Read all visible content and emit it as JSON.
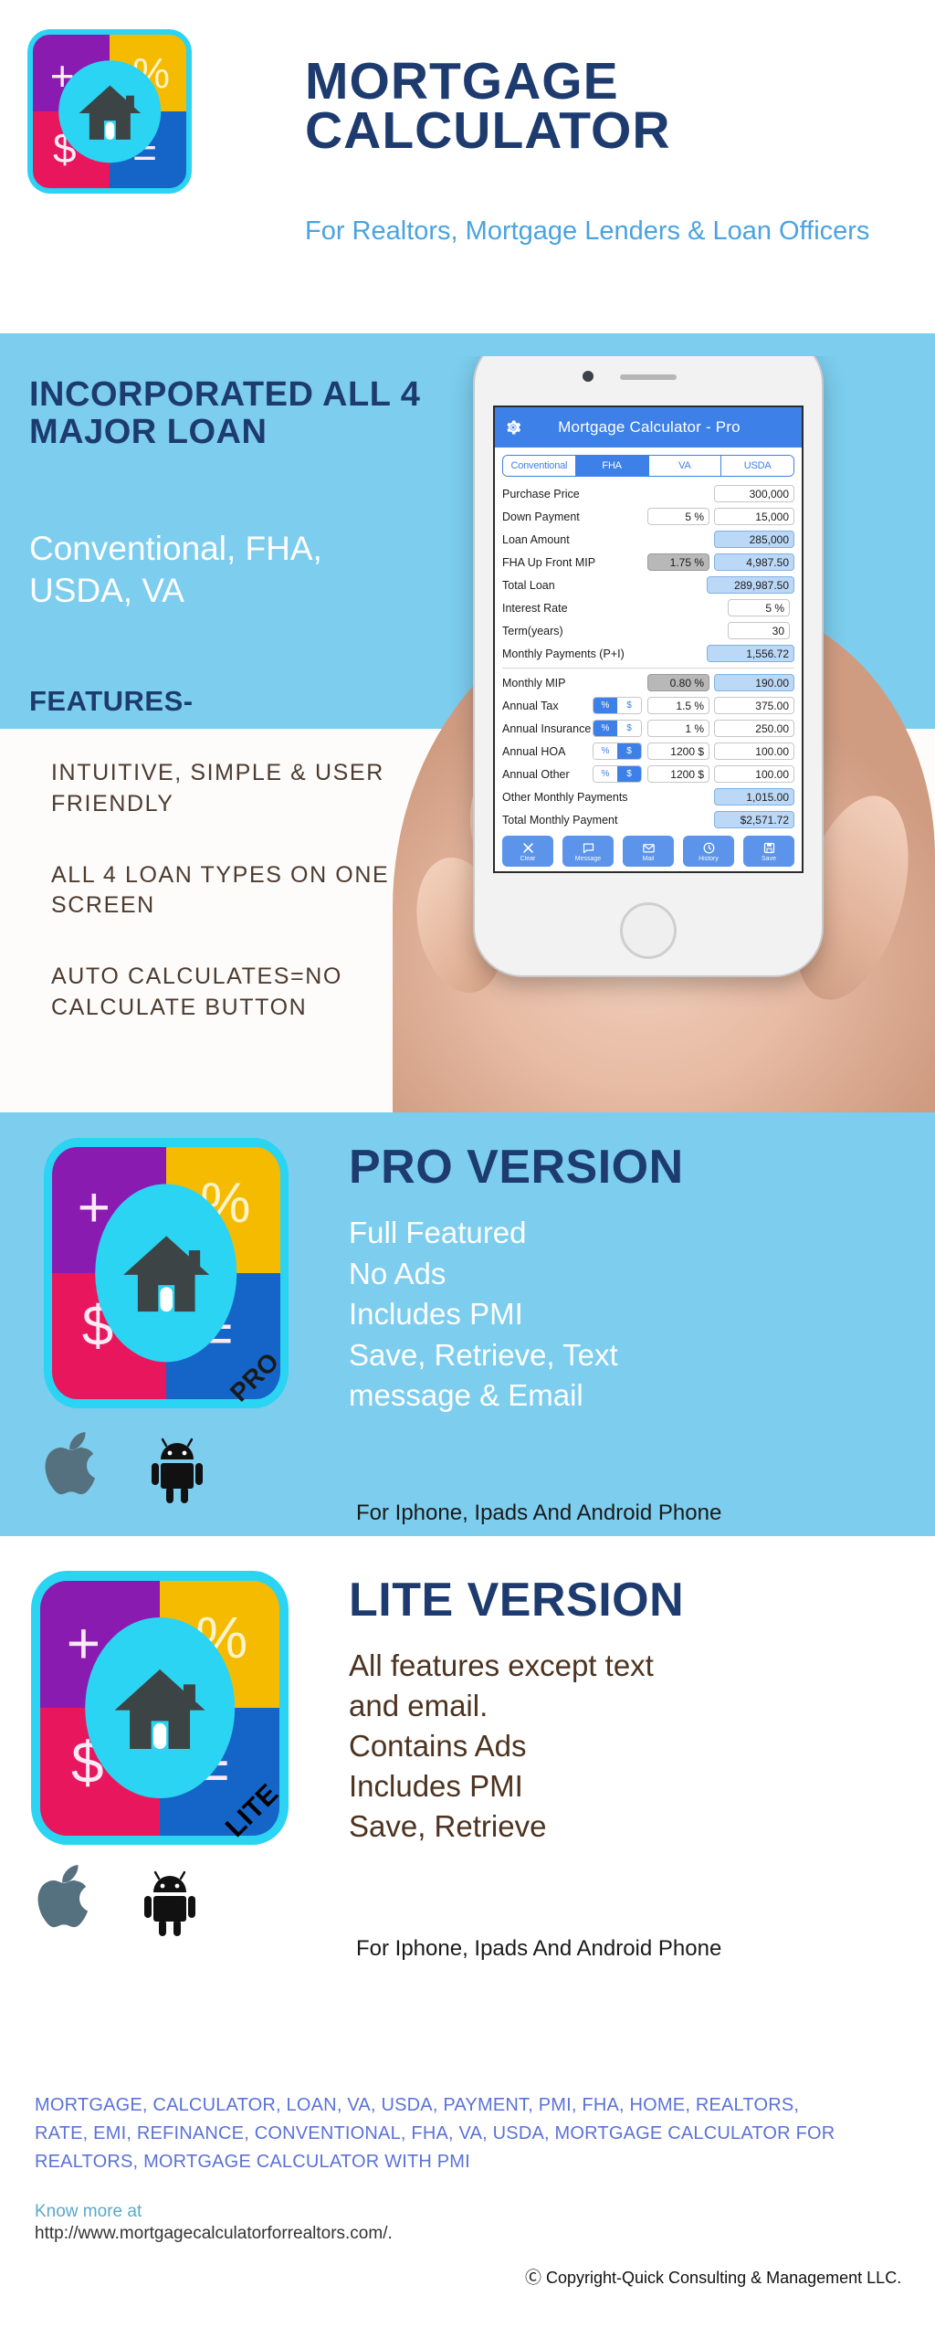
{
  "header": {
    "title_line1": "MORTGAGE",
    "title_line2": "CALCULATOR",
    "subtitle": "For Realtors, Mortgage Lenders & Loan Officers",
    "icon": {
      "plus": "+",
      "percent": "%",
      "dollar": "$",
      "equals": "=",
      "house_name": "house-icon"
    }
  },
  "feature_band": {
    "headline": "INCORPORATED ALL 4 MAJOR LOAN",
    "loan_types": "Conventional, FHA, USDA, VA",
    "features_label": "FEATURES-",
    "features": [
      "INTUITIVE, SIMPLE & USER FRIENDLY",
      "ALL 4 LOAN TYPES ON ONE SCREEN",
      "AUTO CALCULATES=NO CALCULATE BUTTON"
    ]
  },
  "phone_app": {
    "app_title": "Mortgage Calculator - Pro",
    "gear_icon": "gear-icon",
    "tabs": [
      {
        "label": "Conventional",
        "active": false
      },
      {
        "label": "FHA",
        "active": true
      },
      {
        "label": "VA",
        "active": false
      },
      {
        "label": "USDA",
        "active": false
      }
    ],
    "rows": [
      {
        "label": "Purchase Price",
        "pct": "",
        "value": "300,000",
        "value_style": "plain"
      },
      {
        "label": "Down Payment",
        "pct": "5 %",
        "value": "15,000",
        "value_style": "plain"
      },
      {
        "label": "Loan Amount",
        "pct": "",
        "value": "285,000",
        "value_style": "result"
      },
      {
        "label": "FHA Up Front MIP",
        "pct": "1.75 %",
        "value": "4,987.50",
        "value_style": "result",
        "pct_style": "gray"
      },
      {
        "label": "Total Loan",
        "pct": "",
        "value": "289,987.50",
        "value_style": "result",
        "wide": true
      },
      {
        "label": "Interest Rate",
        "pct": "5 %",
        "value": "",
        "value_style": "none"
      },
      {
        "label": "Term(years)",
        "pct": "30",
        "value": "",
        "value_style": "none"
      },
      {
        "label": "Monthly Payments (P+I)",
        "pct": "",
        "value": "1,556.72",
        "value_style": "result",
        "wide": true
      }
    ],
    "rows2": [
      {
        "label": "Monthly MIP",
        "toggle": null,
        "pct": "0.80 %",
        "pct_style": "gray",
        "value": "190.00",
        "value_style": "result"
      },
      {
        "label": "Annual Tax",
        "toggle": {
          "pct": "%",
          "usd": "$",
          "on": "pct"
        },
        "pct": "1.5 %",
        "value": "375.00",
        "value_style": "plain"
      },
      {
        "label": "Annual Insurance",
        "toggle": {
          "pct": "%",
          "usd": "$",
          "on": "pct"
        },
        "pct": "1 %",
        "value": "250.00",
        "value_style": "plain"
      },
      {
        "label": "Annual HOA",
        "toggle": {
          "pct": "%",
          "usd": "$",
          "on": "usd"
        },
        "pct": "1200 $",
        "value": "100.00",
        "value_style": "plain"
      },
      {
        "label": "Annual Other",
        "toggle": {
          "pct": "%",
          "usd": "$",
          "on": "usd"
        },
        "pct": "1200 $",
        "value": "100.00",
        "value_style": "plain"
      }
    ],
    "rows3": [
      {
        "label": "Other Monthly Payments",
        "value": "1,015.00",
        "value_style": "result"
      },
      {
        "label": "Total Monthly Payment",
        "value": "$2,571.72",
        "value_style": "result"
      }
    ],
    "toolbar": [
      {
        "label": "Clear",
        "icon": "close-icon"
      },
      {
        "label": "Message",
        "icon": "chat-bubble-icon"
      },
      {
        "label": "Mail",
        "icon": "envelope-icon"
      },
      {
        "label": "History",
        "icon": "clock-rewind-icon"
      },
      {
        "label": "Save",
        "icon": "floppy-disk-icon"
      }
    ]
  },
  "pro_section": {
    "heading": "PRO VERSION",
    "bullets": [
      "Full Featured",
      "No Ads",
      "Includes PMI",
      "Save, Retrieve, Text",
      "message & Email"
    ],
    "platform_note": "For Iphone, Ipads And Android Phone",
    "badge": "PRO",
    "apple_icon": "apple-logo-icon",
    "android_icon": "android-robot-icon"
  },
  "lite_section": {
    "heading": "LITE VERSION",
    "bullets": [
      "All features except text",
      "and email.",
      "Contains Ads",
      "Includes PMI",
      "Save, Retrieve"
    ],
    "platform_note": "For Iphone, Ipads And Android Phone",
    "badge": "LITE",
    "apple_icon": "apple-logo-icon",
    "android_icon": "android-robot-icon"
  },
  "footer": {
    "keywords": "MORTGAGE, CALCULATOR, LOAN, VA, USDA, PAYMENT, PMI, FHA, HOME, REALTORS, RATE, EMI, REFINANCE, CONVENTIONAL, FHA, VA, USDA, MORTGAGE CALCULATOR FOR REALTORS, MORTGAGE CALCULATOR WITH PMI",
    "know_more_label": "Know more at",
    "url": "http://www.mortgagecalculatorforrealtors.com/.",
    "copyright": "Ⓒ Copyright-Quick Consulting & Management LLC."
  },
  "colors": {
    "brand_navy": "#1d3b6e",
    "sky": "#7ccdee",
    "accent_blue": "#4aa3e0",
    "icon_purple": "#8a1bb0",
    "icon_yellow": "#f5bb00",
    "icon_pink": "#e8175d",
    "icon_blue": "#1565c8",
    "icon_cyan": "#2ad4f2",
    "keyword_blue": "#5b72d8"
  }
}
